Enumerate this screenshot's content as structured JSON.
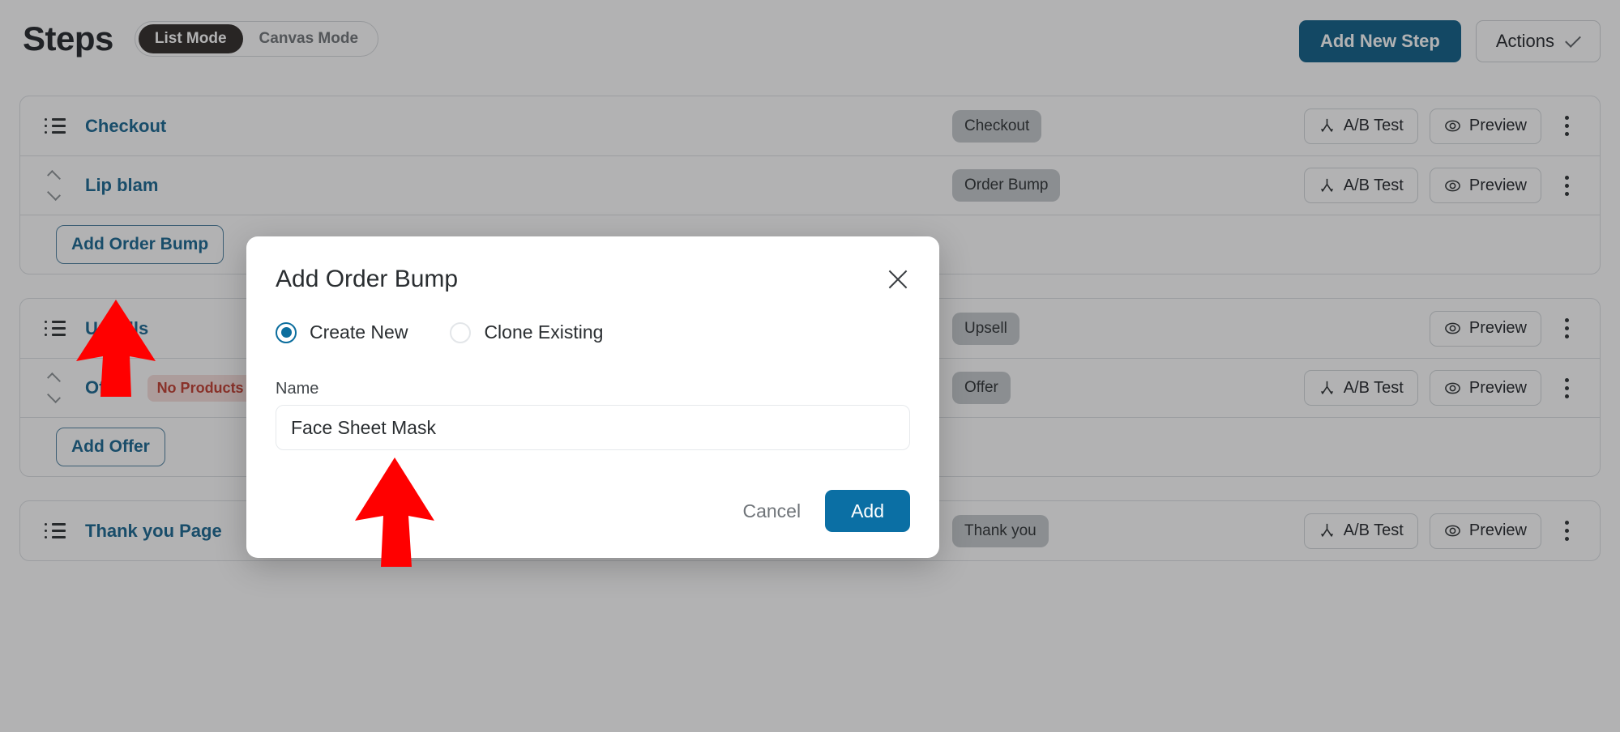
{
  "header": {
    "title": "Steps",
    "modes": [
      {
        "label": "List Mode",
        "active": true
      },
      {
        "label": "Canvas Mode",
        "active": false
      }
    ],
    "add_new_step_label": "Add New Step",
    "actions_label": "Actions",
    "accent_primary": "#0c5d86"
  },
  "groups": [
    {
      "rows": [
        {
          "icon": "list-icon",
          "name": "Checkout",
          "type_badge": "Checkout",
          "buttons": [
            "A/B Test",
            "Preview"
          ],
          "kebab": true
        },
        {
          "icon": "sort-icon",
          "name": "Lip blam",
          "type_badge": "Order Bump",
          "buttons": [
            "A/B Test",
            "Preview"
          ],
          "kebab": true
        }
      ],
      "action_button": "Add Order Bump"
    },
    {
      "rows": [
        {
          "icon": "list-icon",
          "name": "Upsells",
          "type_badge": "Upsell",
          "buttons": [
            "Preview"
          ],
          "kebab": true
        },
        {
          "icon": "sort-icon",
          "name": "Offer",
          "status_badge": "No Products",
          "type_badge": "Offer",
          "buttons": [
            "A/B Test",
            "Preview"
          ],
          "kebab": true
        }
      ],
      "action_button": "Add Offer"
    },
    {
      "rows": [
        {
          "icon": "list-icon",
          "name": "Thank you Page",
          "type_badge": "Thank you",
          "buttons": [
            "A/B Test",
            "Preview"
          ],
          "kebab": true
        }
      ]
    }
  ],
  "modal": {
    "title": "Add Order Bump",
    "close_icon": "close-icon",
    "options": [
      {
        "label": "Create New",
        "selected": true
      },
      {
        "label": "Clone Existing",
        "selected": false
      }
    ],
    "name_label": "Name",
    "name_value": "Face Sheet Mask",
    "name_placeholder": "",
    "cancel_label": "Cancel",
    "add_label": "Add",
    "add_color": "#0b6fa4"
  },
  "annotations": {
    "color": "#ff0000",
    "arrows": [
      {
        "target": "add-order-bump-button",
        "direction": "up"
      },
      {
        "target": "name-input",
        "direction": "up"
      }
    ]
  },
  "colors": {
    "step_link": "#14648f",
    "badge_bg": "#c3c8cb",
    "danger_text": "#c0392b",
    "danger_bg": "#f6dddb",
    "overlay": "rgba(33,33,36,0.35)"
  }
}
